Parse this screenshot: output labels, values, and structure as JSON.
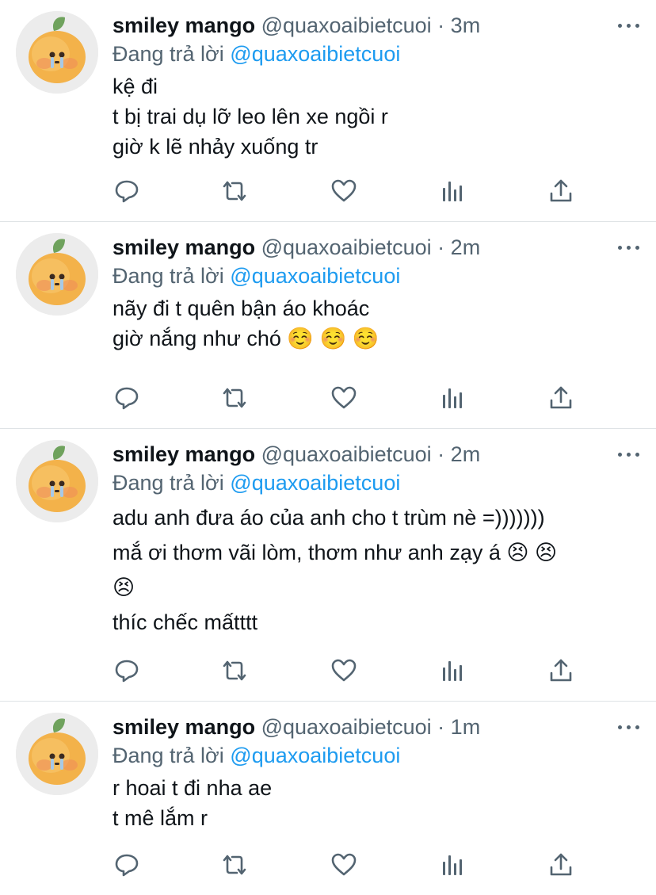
{
  "colors": {
    "text": "#0f1419",
    "secondary": "#536471",
    "accent": "#1d9bf0",
    "divider": "#dfe3e6"
  },
  "icons": [
    "reply-icon",
    "retweet-icon",
    "like-icon",
    "analytics-icon",
    "share-icon",
    "more-icon"
  ],
  "tweets": [
    {
      "name": "smiley mango",
      "handle": "@quaxoaibietcuoi",
      "separator": "·",
      "time": "3m",
      "replying_prefix": "Đang trả lời",
      "replying_to": "@quaxoaibietcuoi",
      "lines": [
        "kệ đi",
        "t bị trai dụ lỡ leo lên xe ngồi r",
        "giờ k lẽ nhảy xuống tr"
      ]
    },
    {
      "name": "smiley mango",
      "handle": "@quaxoaibietcuoi",
      "separator": "·",
      "time": "2m",
      "replying_prefix": "Đang trả lời",
      "replying_to": "@quaxoaibietcuoi",
      "lines": [
        "nãy đi t quên bận áo khoác",
        "giờ nắng như chó ☺️ ☺️ ☺️"
      ]
    },
    {
      "name": "smiley mango",
      "handle": "@quaxoaibietcuoi",
      "separator": "·",
      "time": "2m",
      "replying_prefix": "Đang trả lời",
      "replying_to": "@quaxoaibietcuoi",
      "lines": [
        "adu anh đưa áo của anh cho t trùm nè =)))))))",
        "mắ ơi thơm vãi lòm, thơm như anh zạy á 😣 😣",
        "😣",
        "thíc chếc mấtttt"
      ]
    },
    {
      "name": "smiley mango",
      "handle": "@quaxoaibietcuoi",
      "separator": "·",
      "time": "1m",
      "replying_prefix": "Đang trả lời",
      "replying_to": "@quaxoaibietcuoi",
      "lines": [
        "r hoai t đi nha ae",
        "t mê lắm r"
      ]
    }
  ]
}
